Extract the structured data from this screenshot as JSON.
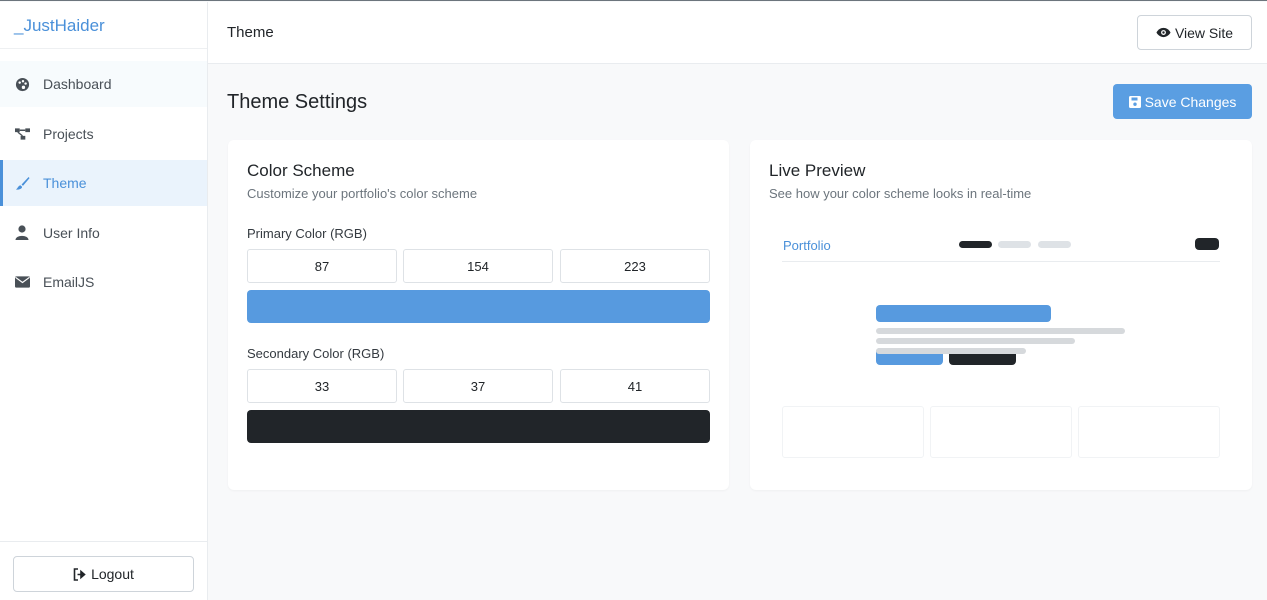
{
  "brand": "_JustHaider",
  "sidebar": {
    "items": [
      {
        "label": "Dashboard",
        "icon": "palette-icon"
      },
      {
        "label": "Projects",
        "icon": "project-diagram-icon"
      },
      {
        "label": "Theme",
        "icon": "brush-icon"
      },
      {
        "label": "User Info",
        "icon": "user-icon"
      },
      {
        "label": "EmailJS",
        "icon": "envelope-icon"
      }
    ],
    "active": "Theme",
    "logout_label": "Logout"
  },
  "header": {
    "title": "Theme",
    "view_site_label": "View Site"
  },
  "main": {
    "page_title": "Theme Settings",
    "save_label": "Save Changes",
    "color_scheme": {
      "title": "Color Scheme",
      "subtitle": "Customize your portfolio's color scheme",
      "primary": {
        "label": "Primary Color (RGB)",
        "r": "87",
        "g": "154",
        "b": "223",
        "hex": "#579adf"
      },
      "secondary": {
        "label": "Secondary Color (RGB)",
        "r": "33",
        "g": "37",
        "b": "41",
        "hex": "#212529"
      }
    },
    "preview": {
      "title": "Live Preview",
      "subtitle": "See how your color scheme looks in real-time",
      "logo": "Portfolio"
    }
  },
  "colors": {
    "accent": "#4a90d9",
    "save_button": "#5a9ee2"
  }
}
